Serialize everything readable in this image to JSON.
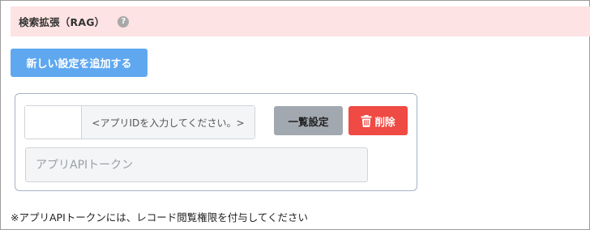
{
  "section": {
    "title": "検索拡張（RAG）",
    "help_glyph": "?"
  },
  "actions": {
    "add_setting_label": "新しい設定を追加する"
  },
  "setting": {
    "app_id_value": "",
    "app_id_hint": "<アプリIDを入力してください。>",
    "bulk_label": "一覧設定",
    "delete_label": "削除",
    "token_placeholder": "アプリAPIトークン",
    "token_value": ""
  },
  "note": "※アプリAPIトークンには、レコード閲覧権限を付与してください",
  "colors": {
    "header_background": "#fde3e3",
    "add_button": "#5fa8f0",
    "bulk_button": "#a2a8b0",
    "delete_button": "#ef4a43",
    "card_border": "#a7b3c4"
  },
  "icons": {
    "help": "help-icon",
    "delete": "trash-icon"
  }
}
